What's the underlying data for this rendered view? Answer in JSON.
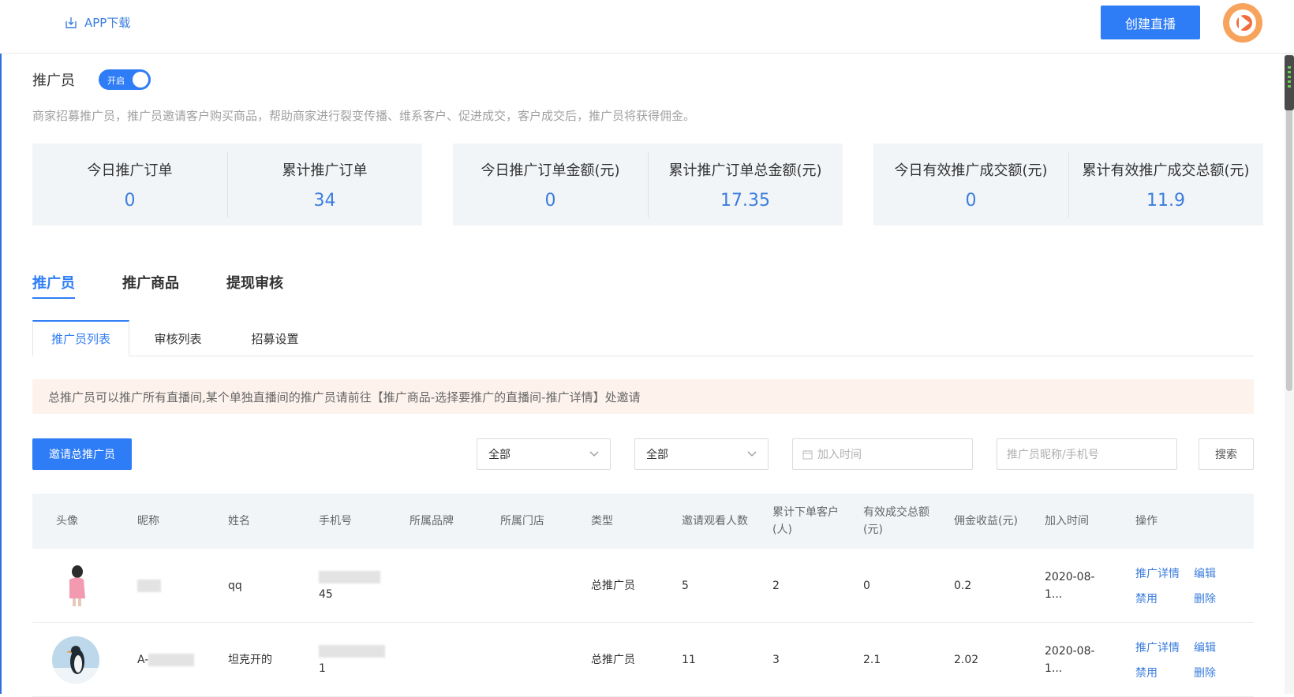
{
  "header": {
    "app_download": "APP下载",
    "create_live": "创建直播",
    "avatar_icon": "logo-icon"
  },
  "promoter": {
    "label": "推广员",
    "toggle_text": "开启",
    "toggle_on": true,
    "description": "商家招募推广员，推广员邀请客户购买商品，帮助商家进行裂变传播、维系客户、促进成交，客户成交后，推广员将获得佣金。"
  },
  "stats": [
    {
      "label": "今日推广订单",
      "value": "0"
    },
    {
      "label": "累计推广订单",
      "value": "34"
    },
    {
      "label": "今日推广订单金额(元)",
      "value": "0"
    },
    {
      "label": "累计推广订单总金额(元)",
      "value": "17.35"
    },
    {
      "label": "今日有效推广成交额(元)",
      "value": "0"
    },
    {
      "label": "累计有效推广成交总额(元)",
      "value": "11.9"
    }
  ],
  "main_tabs": [
    "推广员",
    "推广商品",
    "提现审核"
  ],
  "sub_tabs": [
    "推广员列表",
    "审核列表",
    "招募设置"
  ],
  "notice": "总推广员可以推广所有直播间,某个单独直播间的推广员请前往【推广商品-选择要推广的直播间-推广详情】处邀请",
  "toolbar": {
    "invite_button": "邀请总推广员",
    "select1": "全部",
    "select2": "全部",
    "date_placeholder": "加入时间",
    "search_placeholder": "推广员昵称/手机号",
    "search_button": "搜索"
  },
  "table": {
    "headers": [
      "头像",
      "昵称",
      "姓名",
      "手机号",
      "所属品牌",
      "所属门店",
      "类型",
      "邀请观看人数",
      "累计下单客户(人)",
      "有效成交总额(元)",
      "佣金收益(元)",
      "加入时间",
      "操作"
    ],
    "rows": [
      {
        "nickname": "",
        "name": "qq",
        "phone_tail": "45",
        "brand": "",
        "store": "",
        "type": "总推广员",
        "invites": "5",
        "customers": "2",
        "total": "0",
        "commission": "0.2",
        "join_time": "2020-08-1...",
        "ops": [
          "推广详情",
          "编辑",
          "禁用",
          "删除"
        ]
      },
      {
        "nickname": "A-",
        "name": "坦克开的",
        "phone_tail": "1",
        "brand": "",
        "store": "",
        "type": "总推广员",
        "invites": "11",
        "customers": "3",
        "total": "2.1",
        "commission": "2.02",
        "join_time": "2020-08-1...",
        "ops": [
          "推广详情",
          "编辑",
          "禁用",
          "删除"
        ]
      }
    ]
  },
  "colors": {
    "accent": "#2f7df6",
    "stat_value": "#3b7ddd",
    "notice_bg": "#fdf3ec"
  }
}
